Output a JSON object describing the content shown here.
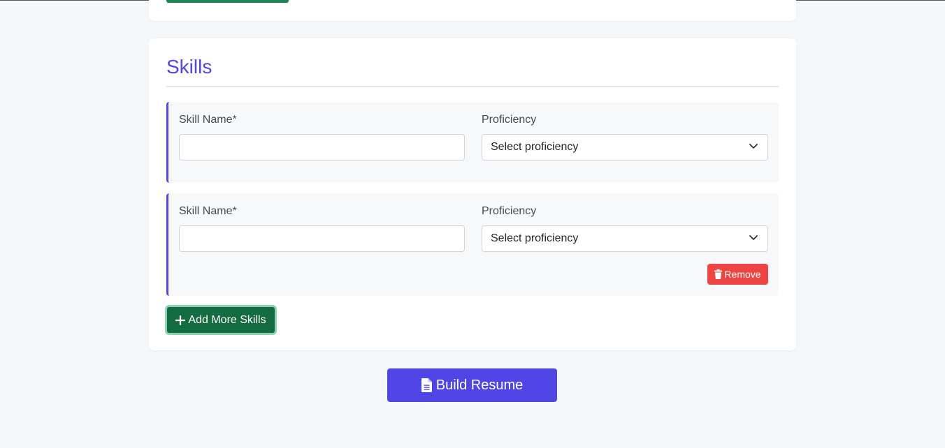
{
  "section": {
    "title": "Skills"
  },
  "skills": [
    {
      "name_label": "Skill Name*",
      "name_value": "",
      "proficiency_label": "Proficiency",
      "proficiency_value": "Select proficiency",
      "removable": false
    },
    {
      "name_label": "Skill Name*",
      "name_value": "",
      "proficiency_label": "Proficiency",
      "proficiency_value": "Select proficiency",
      "removable": true,
      "remove_label": "Remove"
    }
  ],
  "actions": {
    "add_label": "Add More Skills",
    "build_label": "Build Resume"
  },
  "icons": {
    "remove": "trash-icon",
    "add": "plus-icon",
    "build": "file-text-icon",
    "select": "chevron-down-icon"
  },
  "colors": {
    "accent": "#4f46e5",
    "success": "#146c43",
    "danger": "#ef4444",
    "background": "#f5f8fb"
  }
}
